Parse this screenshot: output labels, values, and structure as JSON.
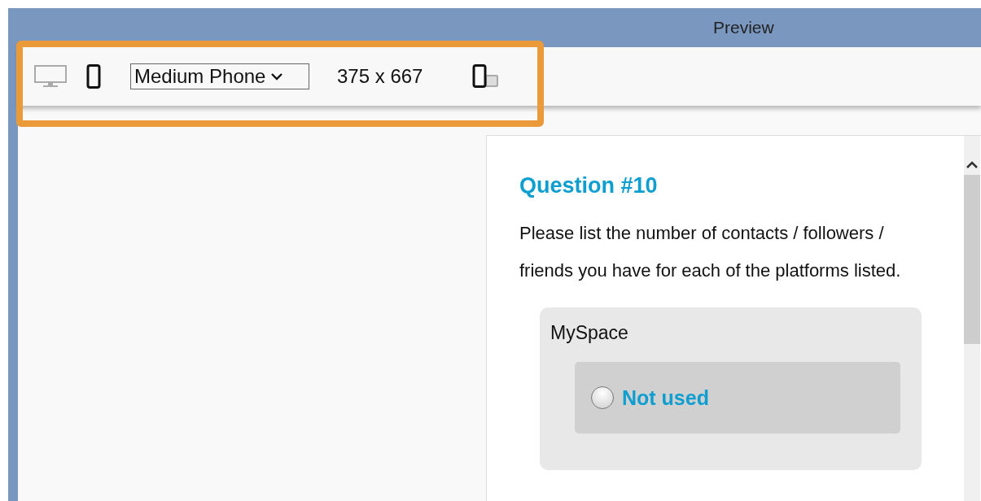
{
  "window": {
    "title": "Preview"
  },
  "toolbar": {
    "devices": [
      {
        "kind": "desktop",
        "selected": false
      },
      {
        "kind": "phone",
        "selected": true
      }
    ],
    "device_select": {
      "value": "Medium Phone"
    },
    "dimensions": "375 x 667"
  },
  "question": {
    "title": "Question #10",
    "text": "Please list the number of contacts / followers / friends you have for each of the platforms listed.",
    "groups": [
      {
        "label": "MySpace",
        "choices": [
          {
            "label": "Not used",
            "selected": false
          }
        ]
      }
    ]
  }
}
